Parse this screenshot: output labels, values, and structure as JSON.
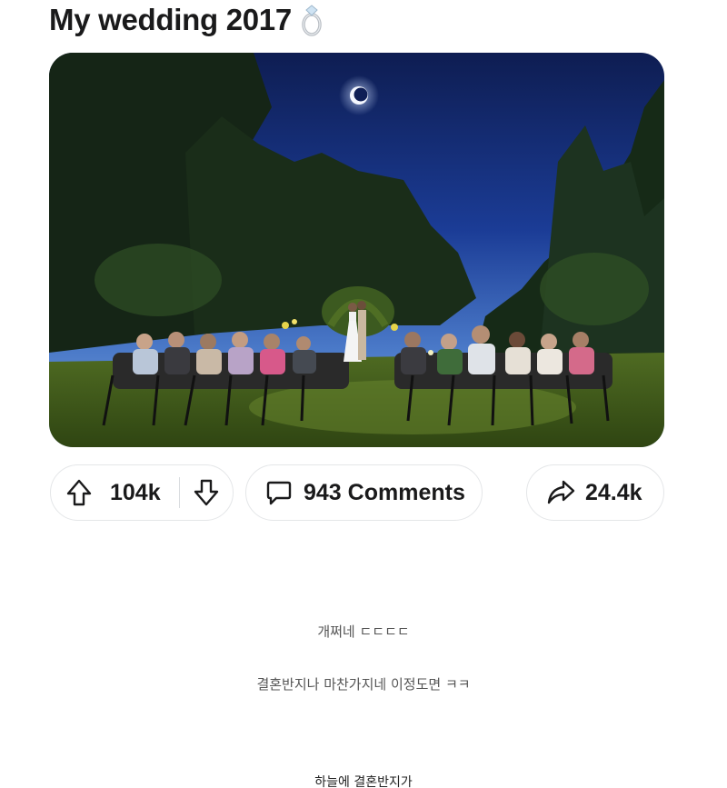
{
  "post": {
    "title": "My wedding 2017",
    "title_emoji": "ring-icon"
  },
  "actions": {
    "upvotes": "104k",
    "comments_label": "943 Comments",
    "shares": "24.4k"
  },
  "captions": {
    "line1": "개쩌네 ㄷㄷㄷㄷ",
    "line2": "결혼반지나 마찬가지네 이정도면 ㅋㅋ",
    "line3": "하늘에 결혼반지가"
  },
  "colors": {
    "text": "#1a1a1b",
    "pill_border": "#e4e6e8",
    "caption": "#555555"
  }
}
